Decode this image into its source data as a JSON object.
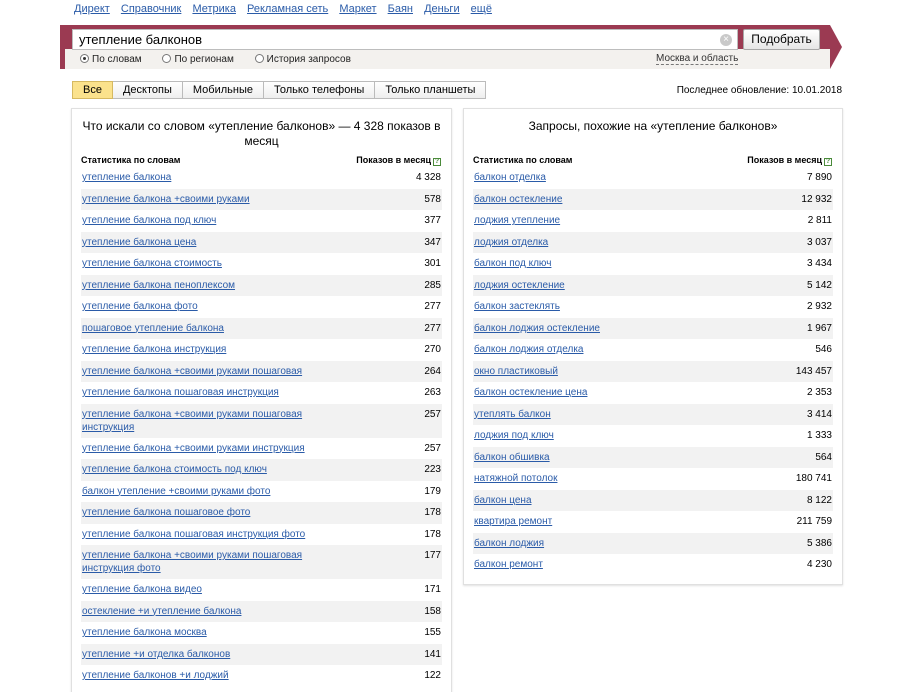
{
  "topnav": [
    "Директ",
    "Справочник",
    "Метрика",
    "Рекламная сеть",
    "Маркет",
    "Баян",
    "Деньги",
    "ещё"
  ],
  "search": {
    "value": "утепление балконов",
    "clear_icon": "×",
    "button": "Подобрать"
  },
  "radios": [
    {
      "label": "По словам",
      "selected": true
    },
    {
      "label": "По регионам",
      "selected": false
    },
    {
      "label": "История запросов",
      "selected": false
    }
  ],
  "region": "Москва и область",
  "tabs": [
    {
      "label": "Все",
      "active": true
    },
    {
      "label": "Десктопы",
      "active": false
    },
    {
      "label": "Мобильные",
      "active": false
    },
    {
      "label": "Только телефоны",
      "active": false
    },
    {
      "label": "Только планшеты",
      "active": false
    }
  ],
  "updated": "Последнее обновление: 10.01.2018",
  "left": {
    "title": "Что искали со словом «утепление балконов» — 4 328 показов в месяц",
    "col_query": "Статистика по словам",
    "col_count": "Показов в месяц",
    "help_icon": "?",
    "rows": [
      {
        "q": "утепление балкона",
        "n": "4 328"
      },
      {
        "q": "утепление балкона +своими руками",
        "n": "578"
      },
      {
        "q": "утепление балкона под ключ",
        "n": "377"
      },
      {
        "q": "утепление балкона цена",
        "n": "347"
      },
      {
        "q": "утепление балкона стоимость",
        "n": "301"
      },
      {
        "q": "утепление балкона пеноплексом",
        "n": "285"
      },
      {
        "q": "утепление балкона фото",
        "n": "277"
      },
      {
        "q": "пошаговое утепление балкона",
        "n": "277"
      },
      {
        "q": "утепление балкона инструкция",
        "n": "270"
      },
      {
        "q": "утепление балкона +своими руками пошаговая",
        "n": "264"
      },
      {
        "q": "утепление балкона пошаговая инструкция",
        "n": "263"
      },
      {
        "q": "утепление балкона +своими руками пошаговая инструкция",
        "n": "257"
      },
      {
        "q": "утепление балкона +своими руками инструкция",
        "n": "257"
      },
      {
        "q": "утепление балкона стоимость под ключ",
        "n": "223"
      },
      {
        "q": "балкон утепление +своими руками фото",
        "n": "179"
      },
      {
        "q": "утепление балкона пошаговое фото",
        "n": "178"
      },
      {
        "q": "утепление балкона пошаговая инструкция фото",
        "n": "178"
      },
      {
        "q": "утепление балкона +своими руками пошаговая инструкция фото",
        "n": "177"
      },
      {
        "q": "утепление балкона видео",
        "n": "171"
      },
      {
        "q": "остекление +и утепление балкона",
        "n": "158"
      },
      {
        "q": "утепление балкона москва",
        "n": "155"
      },
      {
        "q": "утепление +и отделка балконов",
        "n": "141"
      },
      {
        "q": "утепление балконов +и лоджий",
        "n": "122"
      }
    ]
  },
  "right": {
    "title": "Запросы, похожие на «утепление балконов»",
    "col_query": "Статистика по словам",
    "col_count": "Показов в месяц",
    "help_icon": "?",
    "rows": [
      {
        "q": "балкон отделка",
        "n": "7 890"
      },
      {
        "q": "балкон остекление",
        "n": "12 932"
      },
      {
        "q": "лоджия утепление",
        "n": "2 811"
      },
      {
        "q": "лоджия отделка",
        "n": "3 037"
      },
      {
        "q": "балкон под ключ",
        "n": "3 434"
      },
      {
        "q": "лоджия остекление",
        "n": "5 142"
      },
      {
        "q": "балкон застеклять",
        "n": "2 932"
      },
      {
        "q": "балкон лоджия остекление",
        "n": "1 967"
      },
      {
        "q": "балкон лоджия отделка",
        "n": "546"
      },
      {
        "q": "окно пластиковый",
        "n": "143 457"
      },
      {
        "q": "балкон остекление цена",
        "n": "2 353"
      },
      {
        "q": "утеплять балкон",
        "n": "3 414"
      },
      {
        "q": "лоджия под ключ",
        "n": "1 333"
      },
      {
        "q": "балкон обшивка",
        "n": "564"
      },
      {
        "q": "натяжной потолок",
        "n": "180 741"
      },
      {
        "q": "балкон цена",
        "n": "8 122"
      },
      {
        "q": "квартира ремонт",
        "n": "211 759"
      },
      {
        "q": "балкон лоджия",
        "n": "5 386"
      },
      {
        "q": "балкон ремонт",
        "n": "4 230"
      }
    ]
  },
  "colors": {
    "accent": "#9b3a52",
    "link": "#2a5ba8",
    "active_tab": "#fbe28c"
  }
}
